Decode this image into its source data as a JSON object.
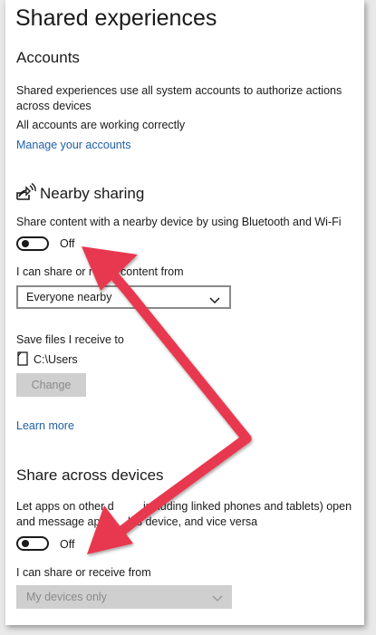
{
  "page": {
    "title": "Shared experiences"
  },
  "accounts": {
    "heading": "Accounts",
    "description": "Shared experiences use all system accounts to authorize actions across devices",
    "status": "All accounts are working correctly",
    "manage_link": "Manage your accounts"
  },
  "nearby": {
    "icon": "nearby-sharing-icon",
    "heading": "Nearby sharing",
    "description": "Share content with a nearby device by using Bluetooth and Wi-Fi",
    "toggle_state": "Off",
    "share_from_label": "I can share or r",
    "share_from_label_tail": "content from",
    "share_from_value": "Everyone nearby",
    "save_label": "Save files I receive to",
    "save_path": "C:\\Users",
    "change_button": "Change",
    "learn_more": "Learn more"
  },
  "across": {
    "heading": "Share across devices",
    "description_line1_a": "Let apps on other d",
    "description_line1_b": "including linked phones and tablets) open",
    "description_line2_a": "and message app",
    "description_line2_b": "his device, and vice versa",
    "toggle_state": "Off",
    "share_label": "I can share or receive from",
    "share_value": "My devices only"
  },
  "colors": {
    "link": "#1f5fa8",
    "annotation_arrow": "#e8384f"
  }
}
